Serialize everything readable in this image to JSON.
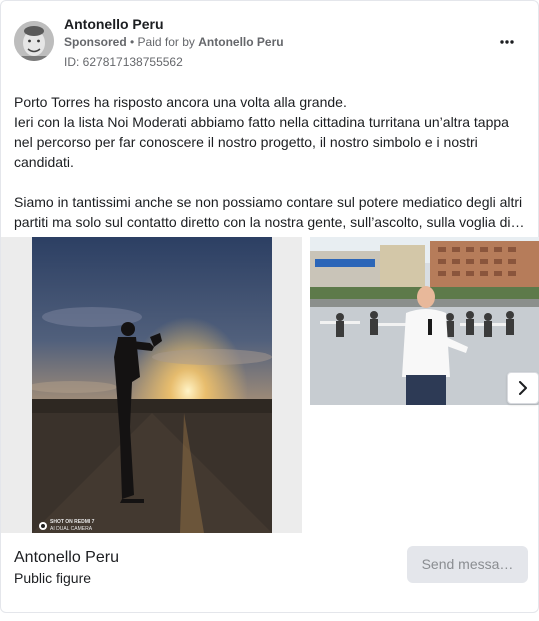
{
  "header": {
    "advertiser_name": "Antonello Peru",
    "sponsored_label": "Sponsored",
    "separator": " • ",
    "paid_for_prefix": "Paid for by ",
    "paid_for_name": "Antonello Peru",
    "ad_id": "ID: 627817138755562",
    "more_icon": "ellipsis-icon"
  },
  "body": {
    "lines": [
      "Porto Torres ha risposto ancora una volta alla grande.",
      "Ieri con la lista Noi Moderati abbiamo fatto nella cittadina turritana un’altra tappa",
      "nel percorso per far conoscere il nostro progetto, il nostro simbolo e i nostri",
      "candidati.",
      "",
      "Siamo in tantissimi anche se non possiamo contare sul potere mediatico degli altri",
      "partiti ma solo sul contatto diretto con la nostra gente, sull’ascolto, sulla voglia di…"
    ]
  },
  "carousel": {
    "watermark_line1": "SHOT ON REDMI 7",
    "watermark_line2": "AI DUAL CAMERA",
    "next_icon": "chevron-right-icon"
  },
  "footer": {
    "page_name": "Antonello Peru",
    "page_category": "Public figure",
    "cta_label": "Send messa…"
  }
}
